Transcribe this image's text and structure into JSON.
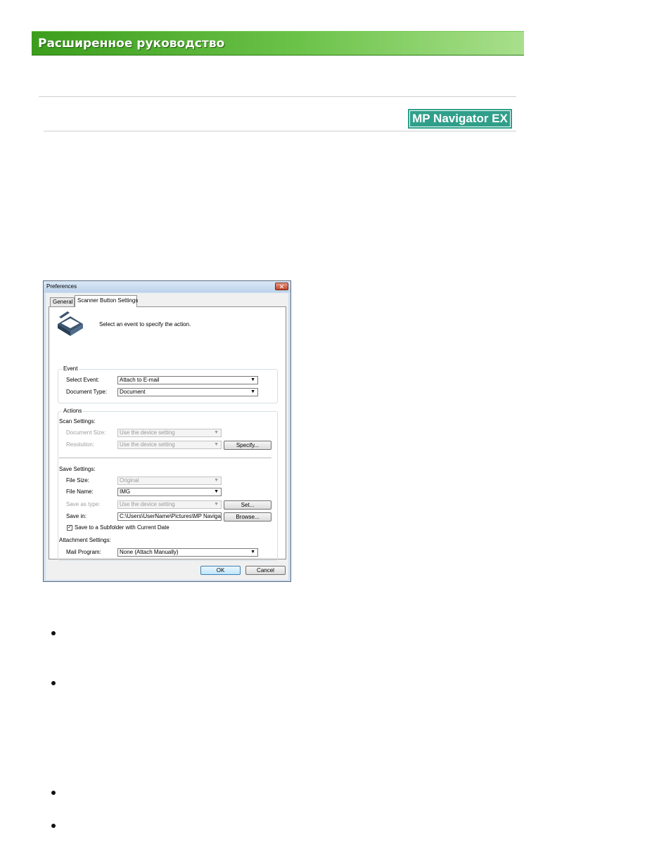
{
  "header": {
    "title": "Расширенное руководство"
  },
  "logo": {
    "text": "MP Navigator EX"
  },
  "dialog": {
    "title": "Preferences",
    "close_glyph": "✕",
    "tabs": [
      "General",
      "Scanner Button Settings"
    ],
    "intro": "Select an event to specify the action.",
    "event": {
      "caption": "Event",
      "select_event_label": "Select Event:",
      "select_event_value": "Attach to E-mail",
      "document_type_label": "Document Type:",
      "document_type_value": "Document"
    },
    "actions": {
      "caption": "Actions",
      "scan_settings": {
        "heading": "Scan Settings:",
        "document_size_label": "Document Size:",
        "document_size_value": "Use the device setting",
        "resolution_label": "Resolution:",
        "resolution_value": "Use the device setting",
        "specify_button": "Specify..."
      },
      "save_settings": {
        "heading": "Save Settings:",
        "file_size_label": "File Size:",
        "file_size_value": "Original",
        "file_name_label": "File Name:",
        "file_name_value": "IMG",
        "save_as_type_label": "Save as type:",
        "save_as_type_value": "Use the device setting",
        "set_button": "Set...",
        "save_in_label": "Save in:",
        "save_in_value": "C:\\Users\\UserName\\Pictures\\MP Navigato",
        "browse_button": "Browse...",
        "subfolder_label": "Save to a Subfolder with Current Date",
        "subfolder_checked": true
      },
      "attachment_settings": {
        "heading": "Attachment Settings:",
        "mail_program_label": "Mail Program:",
        "mail_program_value": "None (Attach Manually)"
      }
    },
    "ok_button": "OK",
    "cancel_button": "Cancel",
    "dropdown_arrow": "▼"
  }
}
